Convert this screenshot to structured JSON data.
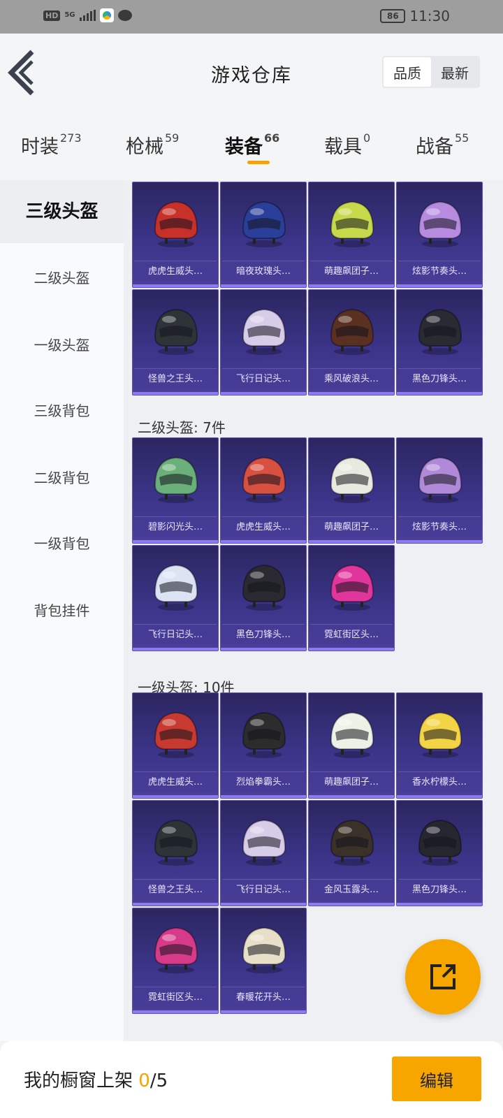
{
  "status_bar": {
    "hd": "HD",
    "network": "5G",
    "battery": "86",
    "time": "11:30"
  },
  "header": {
    "title": "游戏仓库",
    "sort_options": [
      "品质",
      "最新"
    ],
    "sort_selected": "品质"
  },
  "tabs": [
    {
      "label": "时装",
      "count": "273"
    },
    {
      "label": "枪械",
      "count": "59"
    },
    {
      "label": "装备",
      "count": "66"
    },
    {
      "label": "载具",
      "count": "0"
    },
    {
      "label": "战备",
      "count": "55"
    }
  ],
  "active_tab": "装备",
  "sidebar": {
    "items": [
      "三级头盔",
      "二级头盔",
      "一级头盔",
      "三级背包",
      "二级背包",
      "一级背包",
      "背包挂件"
    ],
    "selected": "三级头盔"
  },
  "sections": [
    {
      "label": "",
      "items": [
        "虎虎生威头…",
        "暗夜玫瑰头…",
        "萌趣飙团子…",
        "炫影节奏头…",
        "怪兽之王头…",
        "飞行日记头…",
        "乘风破浪头…",
        "黑色刀锋头…"
      ]
    },
    {
      "label": "二级头盔: 7件",
      "items": [
        "碧影闪光头…",
        "虎虎生威头…",
        "萌趣飙团子…",
        "炫影节奏头…",
        "飞行日记头…",
        "黑色刀锋头…",
        "霓虹街区头…"
      ]
    },
    {
      "label": "一级头盔: 10件",
      "items": [
        "虎虎生威头…",
        "烈焰拳霸头…",
        "萌趣飙团子…",
        "香水柠檬头…",
        "怪兽之王头…",
        "飞行日记头…",
        "金风玉露头…",
        "黑色刀锋头…",
        "霓虹街区头…",
        "春暖花开头…"
      ]
    }
  ],
  "bottom_bar": {
    "label": "我的橱窗上架 ",
    "shelved": "0",
    "total": "/5",
    "edit_label": "编辑"
  },
  "colors": {
    "accent": "#f7a600",
    "card_bg": "#3b3488",
    "helmet_colors": [
      "#c8302a",
      "#2a3f9a",
      "#c6d94a",
      "#b68be0",
      "#2e3338",
      "#d8cde8",
      "#5a3020",
      "#2a2a33",
      "#6bb07a",
      "#d85040",
      "#e8eae0",
      "#b08ad8",
      "#dce4f4",
      "#2a2a30",
      "#e0359a",
      "#c83a30",
      "#2c2c2c",
      "#eef2e6",
      "#f3d446",
      "#2e3338",
      "#d8cde8",
      "#3a3228",
      "#26262e",
      "#d83a8a",
      "#e8dfc8"
    ]
  }
}
